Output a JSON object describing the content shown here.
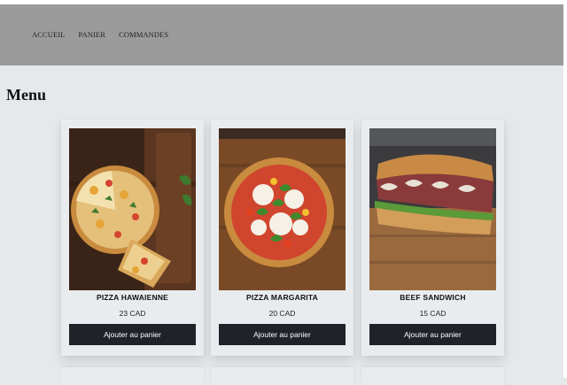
{
  "nav": {
    "links": [
      "ACCUEIL",
      "PANIER",
      "COMMANDES"
    ]
  },
  "page": {
    "title": "Menu"
  },
  "products": [
    {
      "name": "PIZZA HAWAIENNE",
      "price": "23 CAD",
      "button": "Ajouter au panier"
    },
    {
      "name": "PIZZA MARGARITA",
      "price": "20 CAD",
      "button": "Ajouter au panier"
    },
    {
      "name": "BEEF SANDWICH",
      "price": "15 CAD",
      "button": "Ajouter au panier"
    }
  ],
  "colors": {
    "navbar": "#9b9b9b",
    "background": "#e6e9eb",
    "card": "#e9ecee",
    "button": "#1f2229"
  }
}
